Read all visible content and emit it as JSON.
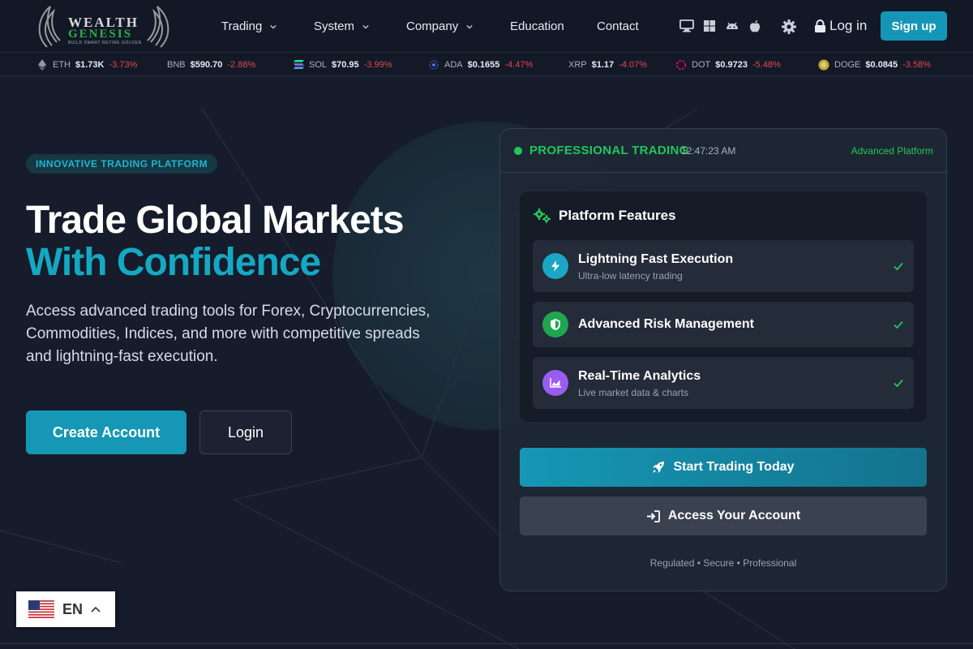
{
  "brand": {
    "line1": "WEALTH",
    "line2": "GENESIS",
    "tagline": "BUILD SMART RETIRE GOLDEN"
  },
  "nav": {
    "items": [
      {
        "label": "Trading",
        "has_dropdown": true
      },
      {
        "label": "System",
        "has_dropdown": true
      },
      {
        "label": "Company",
        "has_dropdown": true
      },
      {
        "label": "Education",
        "has_dropdown": false
      },
      {
        "label": "Contact",
        "has_dropdown": false
      }
    ],
    "platform_icons": [
      "desktop-icon",
      "windows-icon",
      "android-icon",
      "apple-icon"
    ],
    "theme_icon": "gear-icon",
    "login_label": "Log in",
    "signup_label": "Sign up"
  },
  "ticker": [
    {
      "symbol": "ETH",
      "price": "$1.73K",
      "change": "-3.73%"
    },
    {
      "symbol": "BNB",
      "price": "$590.70",
      "change": "-2.88%"
    },
    {
      "symbol": "SOL",
      "price": "$70.95",
      "change": "-3.99%"
    },
    {
      "symbol": "ADA",
      "price": "$0.1655",
      "change": "-4.47%"
    },
    {
      "symbol": "XRP",
      "price": "$1.17",
      "change": "-4.07%"
    },
    {
      "symbol": "DOT",
      "price": "$0.9723",
      "change": "-5.48%"
    },
    {
      "symbol": "DOGE",
      "price": "$0.0845",
      "change": "-3.58%"
    }
  ],
  "hero": {
    "badge": "INNOVATIVE TRADING PLATFORM",
    "title_line1": "Trade Global Markets",
    "title_line2": "With Confidence",
    "description": "Access advanced trading tools for Forex, Cryptocurrencies, Commodities, Indices, and more with competitive spreads and lightning-fast execution.",
    "primary_cta": "Create Account",
    "secondary_cta": "Login"
  },
  "card": {
    "status": "PROFESSIONAL TRADING",
    "time": "12:47:23 AM",
    "platform_label": "Advanced Platform",
    "features_title": "Platform Features",
    "features": [
      {
        "title": "Lightning Fast Execution",
        "subtitle": "Ultra-low latency trading",
        "icon": "bolt-icon"
      },
      {
        "title": "Advanced Risk Management",
        "subtitle": "",
        "icon": "shield-icon"
      },
      {
        "title": "Real-Time Analytics",
        "subtitle": "Live market data & charts",
        "icon": "chart-icon"
      }
    ],
    "start_label": "Start Trading Today",
    "access_label": "Access Your Account",
    "footer": "Regulated • Secure • Professional"
  },
  "language": {
    "code": "EN"
  },
  "colors": {
    "accent": "#1597b5",
    "teal_text": "#14a9c2",
    "green": "#22c55e",
    "negative": "#e5484d",
    "background": "#161c2b"
  }
}
